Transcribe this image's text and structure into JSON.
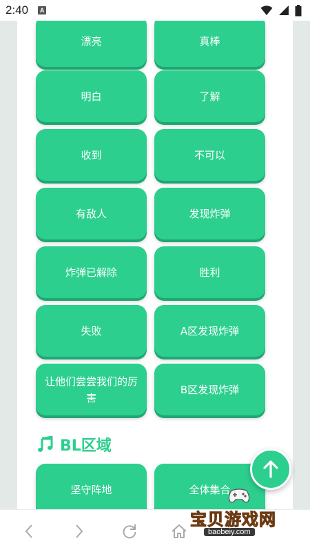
{
  "status_bar": {
    "time": "2:40",
    "notification_letter": "A"
  },
  "buttons": [
    {
      "label": "漂亮",
      "name": "voice-button-beautiful"
    },
    {
      "label": "真棒",
      "name": "voice-button-awesome"
    },
    {
      "label": "明白",
      "name": "voice-button-understood"
    },
    {
      "label": "了解",
      "name": "voice-button-got-it"
    },
    {
      "label": "收到",
      "name": "voice-button-received"
    },
    {
      "label": "不可以",
      "name": "voice-button-not-allowed"
    },
    {
      "label": "有敌人",
      "name": "voice-button-enemy-spotted"
    },
    {
      "label": "发现炸弹",
      "name": "voice-button-bomb-found"
    },
    {
      "label": "炸弹已解除",
      "name": "voice-button-bomb-defused"
    },
    {
      "label": "胜利",
      "name": "voice-button-victory"
    },
    {
      "label": "失败",
      "name": "voice-button-defeat"
    },
    {
      "label": "A区发现炸弹",
      "name": "voice-button-bomb-site-a"
    },
    {
      "label": "让他们尝尝我们的厉害",
      "name": "voice-button-show-them"
    },
    {
      "label": "B区发现炸弹",
      "name": "voice-button-bomb-site-b"
    }
  ],
  "section": {
    "title": "BL区域",
    "icon": "music-note-icon"
  },
  "section_buttons": [
    {
      "label": "坚守阵地",
      "name": "voice-button-hold-position"
    },
    {
      "label": "全体集合",
      "name": "voice-button-regroup"
    }
  ],
  "fab": {
    "icon": "arrow-up-icon"
  },
  "nav": {
    "icons": [
      "back-icon",
      "forward-icon",
      "reload-icon",
      "home-icon"
    ]
  },
  "watermark": {
    "text": "宝贝游戏网",
    "url": "baobeiy.com"
  },
  "colors": {
    "accent": "#2ccf8e",
    "accent_shadow": "#1fa773",
    "background": "#e3e9e6"
  }
}
